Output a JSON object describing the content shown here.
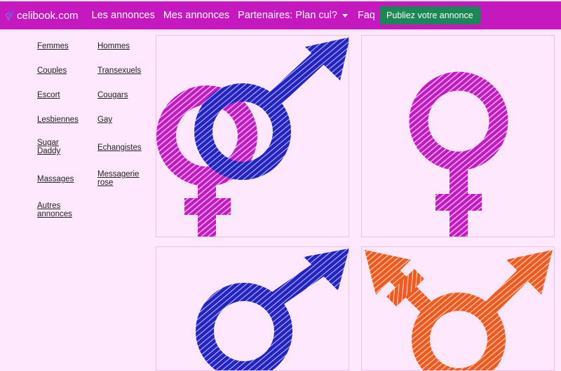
{
  "brand": {
    "name": "celibook.com",
    "icon": "gender-symbol-icon"
  },
  "nav": {
    "annonces": "Les annonces",
    "mes_annonces": "Mes annonces",
    "partenaires": "Partenaires: Plan cul?",
    "faq": "Faq",
    "publish": "Publiez votre annonce"
  },
  "categories": {
    "femmes": "Femmes",
    "hommes": "Hommes",
    "couples": "Couples",
    "transexuels": "Transexuels",
    "escort": "Escort",
    "cougars": "Cougars",
    "lesbiennes": "Lesbiennes",
    "gay": "Gay",
    "sugar_daddy": "Sugar Daddy",
    "echangistes": "Echangistes",
    "massages": "Massages",
    "messagerie_rose": "Messagerie rose",
    "autres": "Autres annonces"
  },
  "tiles": [
    {
      "icon": "couple-male-female-symbol-icon",
      "colors": [
        "#c21bc2",
        "#2424c4"
      ]
    },
    {
      "icon": "female-symbol-icon",
      "colors": [
        "#c21bc2"
      ]
    },
    {
      "icon": "male-symbol-icon",
      "colors": [
        "#2424c4"
      ]
    },
    {
      "icon": "transgender-symbol-icon",
      "colors": [
        "#f05a1e"
      ]
    }
  ],
  "colors": {
    "navbar": "#c518bf",
    "publish_button": "#1a8754",
    "background": "#fde8fd",
    "pink": "#c21bc2",
    "blue": "#2424c4",
    "orange": "#f05a1e"
  }
}
